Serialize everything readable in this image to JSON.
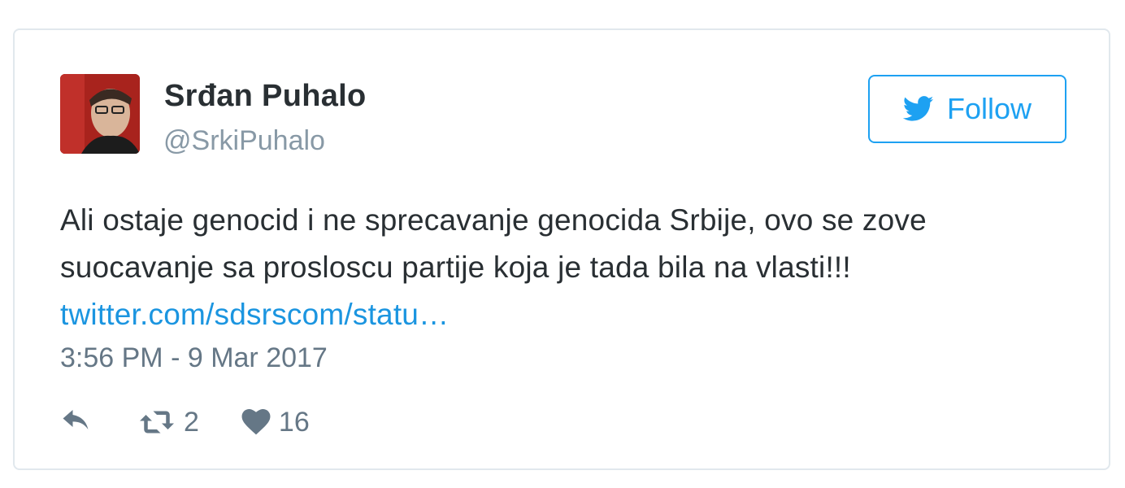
{
  "tweet": {
    "author": {
      "display_name": "Srđan Puhalo",
      "handle": "@SrkiPuhalo",
      "avatar_bg": "#b32a22"
    },
    "follow_button": {
      "label": "Follow",
      "icon": "twitter-bird-icon",
      "color": "#1da1f2"
    },
    "text": "Ali ostaje genocid i ne sprecavanje genocida Srbije, ovo se zove suocavanje sa prosloscu partije koja je tada bila na vlasti!!! ",
    "link_text": "twitter.com/sdsrscom/statu…",
    "link_color": "#1b95e0",
    "timestamp": "3:56 PM - 9 Mar 2017",
    "actions": {
      "reply": {
        "icon": "reply-icon"
      },
      "retweet": {
        "icon": "retweet-icon",
        "count": "2"
      },
      "like": {
        "icon": "heart-icon",
        "count": "16"
      }
    }
  }
}
